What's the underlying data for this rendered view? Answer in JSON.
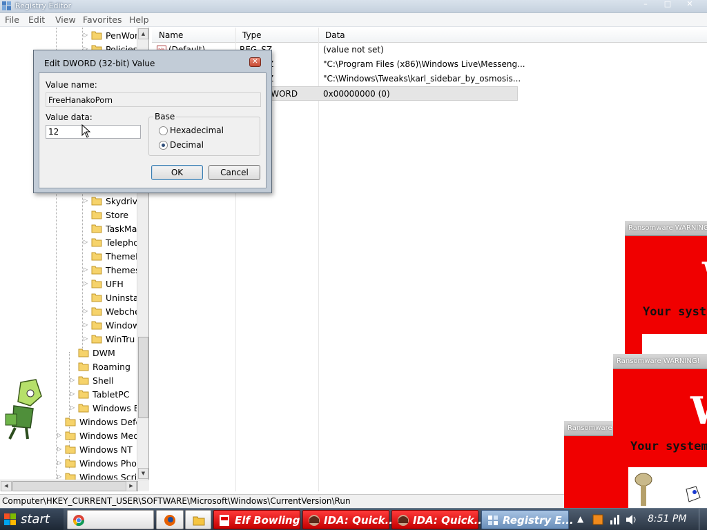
{
  "window": {
    "title": "Registry Editor",
    "controls": [
      "–",
      "□",
      "✕"
    ]
  },
  "menu": [
    "File",
    "Edit",
    "View",
    "Favorites",
    "Help"
  ],
  "tree": [
    {
      "label": "PenWor",
      "expandable": true
    },
    {
      "label": "Policies",
      "expandable": true
    },
    {
      "label": "Skydriv",
      "expandable": true
    },
    {
      "label": "Store",
      "expandable": false
    },
    {
      "label": "TaskMa",
      "expandable": false
    },
    {
      "label": "Telepho",
      "expandable": true
    },
    {
      "label": "ThemeM",
      "expandable": false
    },
    {
      "label": "Themes",
      "expandable": true
    },
    {
      "label": "UFH",
      "expandable": true
    },
    {
      "label": "Uninsta",
      "expandable": false
    },
    {
      "label": "Webche",
      "expandable": true
    },
    {
      "label": "Window",
      "expandable": true
    },
    {
      "label": "WinTru",
      "expandable": true
    },
    {
      "label": "DWM",
      "expandable": false
    },
    {
      "label": "Roaming",
      "expandable": false
    },
    {
      "label": "Shell",
      "expandable": true
    },
    {
      "label": "TabletPC",
      "expandable": true
    },
    {
      "label": "Windows E",
      "expandable": true
    },
    {
      "label": "Windows Defe",
      "expandable": false
    },
    {
      "label": "Windows Medi",
      "expandable": true
    },
    {
      "label": "Windows NT",
      "expandable": true
    },
    {
      "label": "Windows Phot",
      "expandable": true
    },
    {
      "label": "Windows Scri",
      "expandable": true
    }
  ],
  "list": {
    "columns": [
      "Name",
      "Type",
      "Data"
    ],
    "rows": [
      {
        "name": "(Default)",
        "type": "REG_SZ",
        "data": "(value not set)"
      },
      {
        "name": "",
        "type": "Z",
        "data": "\"C:\\Program Files (x86)\\Windows Live\\Messeng..."
      },
      {
        "name": "",
        "type": "Z",
        "data": "\"C:\\Windows\\Tweaks\\karl_sidebar_by_osmosis..."
      },
      {
        "name": "",
        "type": "DWORD",
        "data": "0x00000000 (0)"
      }
    ]
  },
  "status": "Computer\\HKEY_CURRENT_USER\\SOFTWARE\\Microsoft\\Windows\\CurrentVersion\\Run",
  "dialog": {
    "title": "Edit DWORD (32-bit) Value",
    "value_name_label": "Value name:",
    "value_name": "FreeHanakoPorn",
    "value_data_label": "Value data:",
    "value_data": "12",
    "base_label": "Base",
    "hex_label": "Hexadecimal",
    "dec_label": "Decimal",
    "selected_base": "Decimal",
    "ok": "OK",
    "cancel": "Cancel",
    "close": "✕"
  },
  "ransom": [
    {
      "title": "Ransomware WARNING!!",
      "big": "W",
      "msg": "Your syst"
    },
    {
      "title": "Ransomware WARNING!",
      "big": "W",
      "msg": "Your system"
    },
    {
      "title": "Ransomware",
      "big": "",
      "msg": ""
    }
  ],
  "taskbar": {
    "start": "start",
    "items": [
      {
        "label": "",
        "style": "light"
      },
      {
        "label": "",
        "style": "light"
      },
      {
        "label": "",
        "style": "light"
      },
      {
        "label": "Elf Bowling",
        "style": "red"
      },
      {
        "label": "IDA: Quick...",
        "style": "red"
      },
      {
        "label": "IDA: Quick...",
        "style": "red"
      },
      {
        "label": "Registry E...",
        "style": "blue"
      }
    ],
    "clock": "8:51 PM"
  },
  "colors": {
    "ransom_red": "#f00000",
    "taskbar_red": "#e00000",
    "selection": "#e5e5e5"
  }
}
